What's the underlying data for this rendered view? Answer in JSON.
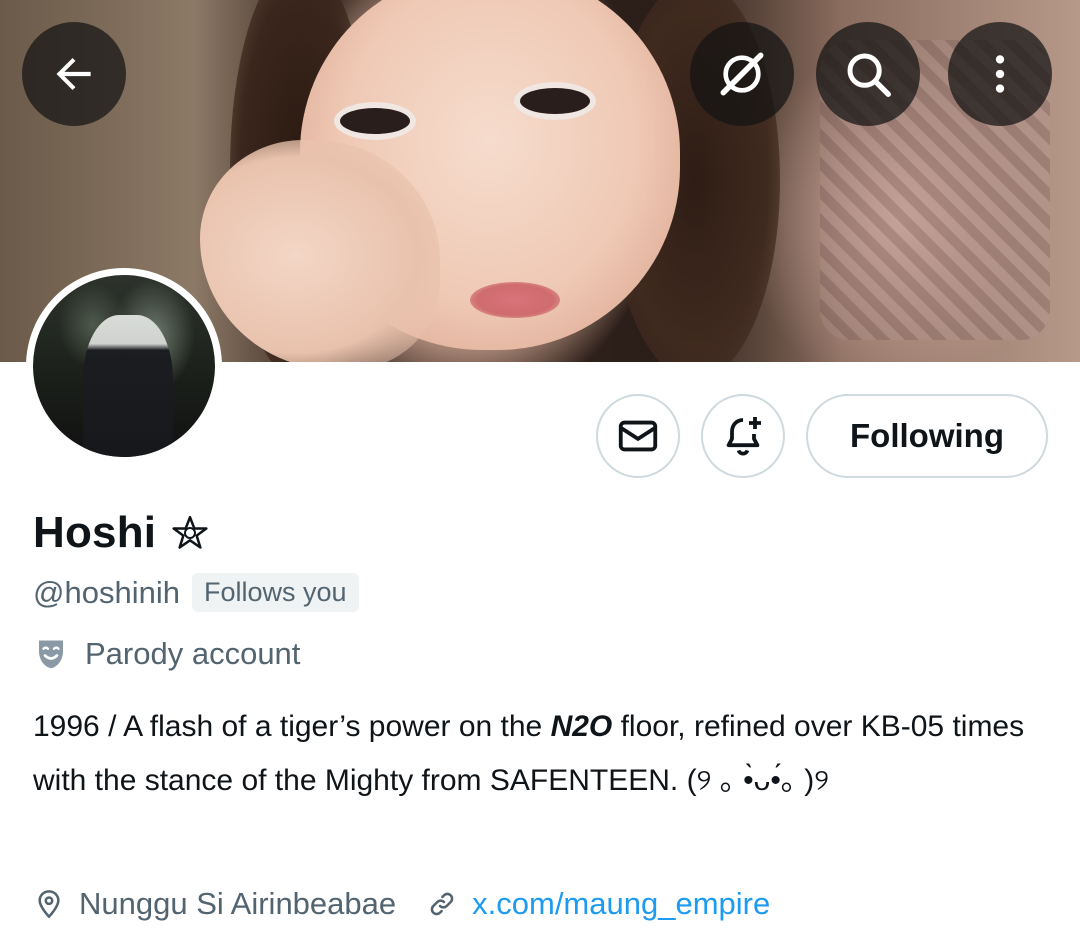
{
  "header": {
    "back_icon": "arrow-left-icon",
    "grok_icon": "grok-icon",
    "search_icon": "search-icon",
    "more_icon": "more-vertical-icon"
  },
  "actions": {
    "message_icon": "envelope-icon",
    "notify_icon": "bell-plus-icon",
    "follow_label": "Following"
  },
  "profile": {
    "name": "Hoshi",
    "name_emoji": "pentagram-star-icon",
    "handle": "@hoshinih",
    "follows_you": "Follows you",
    "parody_label": "Parody account",
    "bio_part1": "1996 / A flash of a tiger’s power on the ",
    "bio_bold": "N2O",
    "bio_part2": " floor, refined over KB-05 times with the stance of the Mighty from SAFENTEEN. (୨ ｡ •̀ᴗ•́｡ )୨",
    "location": "Nunggu Si Airinbeabae",
    "website": "x.com/maung_empire"
  },
  "colors": {
    "text_primary": "#0f1419",
    "text_secondary": "#536471",
    "link": "#1d9bf0",
    "border": "#cfd9de"
  }
}
